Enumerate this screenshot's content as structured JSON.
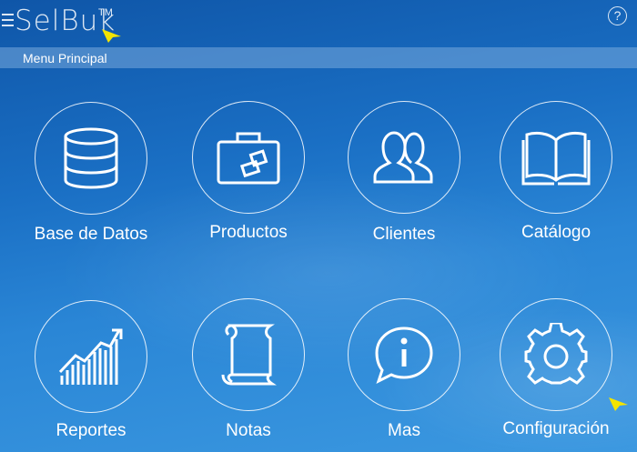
{
  "header": {
    "logo": "SelBuk",
    "trademark": "TM",
    "help_symbol": "?"
  },
  "subheader": {
    "title": "Menu Principal"
  },
  "menu": {
    "items": [
      {
        "label": "Base de Datos",
        "icon": "database-icon"
      },
      {
        "label": "Productos",
        "icon": "briefcase-icon"
      },
      {
        "label": "Clientes",
        "icon": "users-icon"
      },
      {
        "label": "Catálogo",
        "icon": "book-icon"
      },
      {
        "label": "Reportes",
        "icon": "chart-icon"
      },
      {
        "label": "Notas",
        "icon": "scroll-icon"
      },
      {
        "label": "Mas",
        "icon": "info-speech-icon"
      },
      {
        "label": "Configuración",
        "icon": "gear-icon"
      }
    ]
  },
  "colors": {
    "background_top": "#0f56a8",
    "background_bottom": "#3b98e0",
    "cursor": "#f3e400"
  }
}
